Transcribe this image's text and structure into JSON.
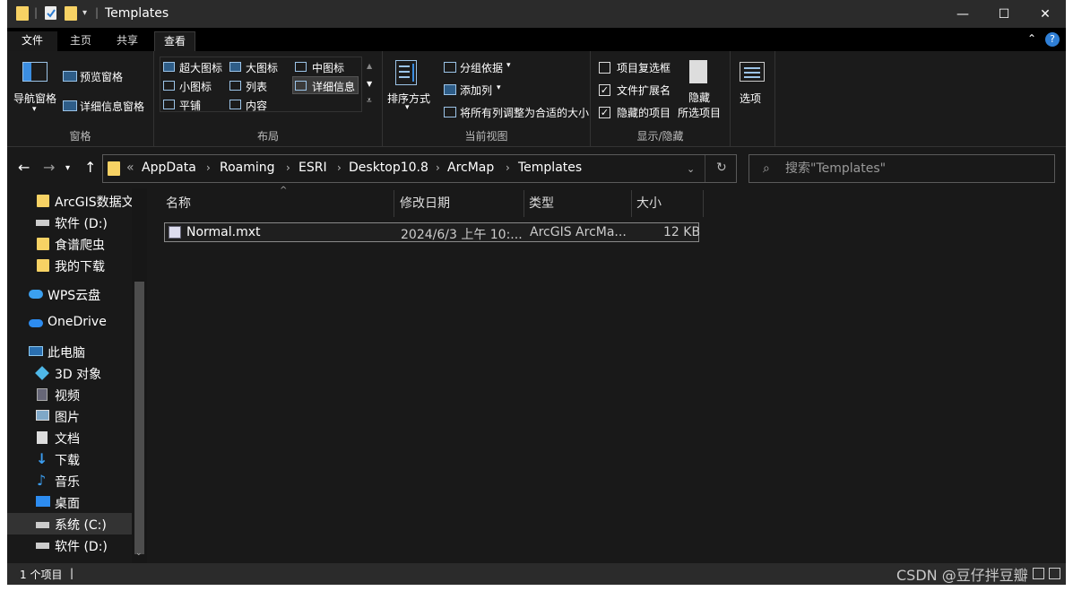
{
  "window": {
    "title": "Templates",
    "minimize": "—",
    "maximize": "☐",
    "close": "✕"
  },
  "ribbon_tabs": [
    "文件",
    "主页",
    "共享",
    "查看"
  ],
  "ribbon": {
    "panes": {
      "label": "窗格",
      "nav_pane": "导航窗格",
      "preview": "预览窗格",
      "details": "详细信息窗格"
    },
    "layout": {
      "label": "布局",
      "items": [
        "超大图标",
        "大图标",
        "中图标",
        "小图标",
        "列表",
        "详细信息",
        "平铺",
        "内容"
      ]
    },
    "current_view": {
      "label": "当前视图",
      "sort": "排序方式",
      "group": "分组依据",
      "add_col": "添加列",
      "fit_cols": "将所有列调整为合适的大小"
    },
    "show_hide": {
      "label": "显示/隐藏",
      "item_checkboxes": "项目复选框",
      "extensions": "文件扩展名",
      "hidden_items": "隐藏的项目",
      "hide_selected_1": "隐藏",
      "hide_selected_2": "所选项目"
    },
    "options": "选项"
  },
  "address": {
    "crumbs": [
      "AppData",
      "Roaming",
      "ESRI",
      "Desktop10.8",
      "ArcMap",
      "Templates"
    ],
    "more": "«"
  },
  "search": {
    "placeholder": "搜索\"Templates\""
  },
  "nav_items": [
    "ArcGIS数据文",
    "软件 (D:)",
    "食谱爬虫",
    "我的下载",
    "WPS云盘",
    "OneDrive",
    "此电脑",
    "3D 对象",
    "视频",
    "图片",
    "文档",
    "下载",
    "音乐",
    "桌面",
    "系统 (C:)",
    "软件 (D:)"
  ],
  "columns": [
    "名称",
    "修改日期",
    "类型",
    "大小"
  ],
  "files": [
    {
      "name": "Normal.mxt",
      "date": "2024/6/3 上午 10:...",
      "type": "ArcGIS ArcMa...",
      "size": "12 KB"
    }
  ],
  "status": {
    "count": "1 个项目"
  },
  "watermark": "CSDN @豆仔拌豆瓣",
  "colors": {
    "background": "#191919",
    "folder": "#f7d264",
    "accent": "#4a9fe0"
  }
}
